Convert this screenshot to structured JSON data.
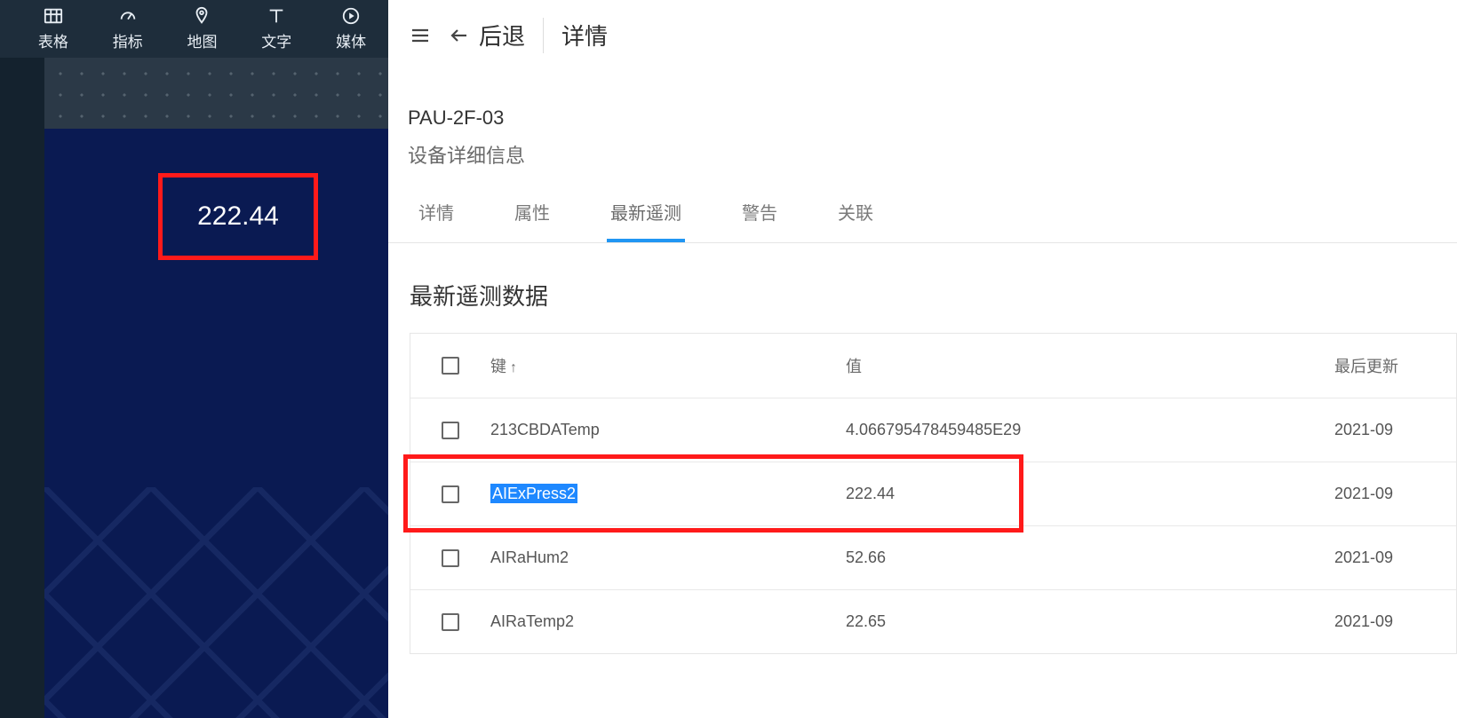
{
  "toolbar": {
    "items": [
      {
        "id": "table",
        "label": "表格"
      },
      {
        "id": "gauge",
        "label": "指标"
      },
      {
        "id": "map",
        "label": "地图"
      },
      {
        "id": "text",
        "label": "文字"
      },
      {
        "id": "media",
        "label": "媒体"
      }
    ]
  },
  "card": {
    "value": "222.44"
  },
  "header": {
    "back": "后退",
    "title": "详情"
  },
  "device": {
    "name": "PAU-2F-03",
    "sub": "设备详细信息"
  },
  "tabs": [
    {
      "id": "detail",
      "label": "详情"
    },
    {
      "id": "attr",
      "label": "属性"
    },
    {
      "id": "telemetry",
      "label": "最新遥测",
      "active": true
    },
    {
      "id": "alarm",
      "label": "警告"
    },
    {
      "id": "relation",
      "label": "关联"
    }
  ],
  "sectionTitle": "最新遥测数据",
  "columns": {
    "key": "键",
    "value": "值",
    "time": "最后更新"
  },
  "rows": [
    {
      "key": "213CBDATemp",
      "value": "4.066795478459485E29",
      "time": "2021-09"
    },
    {
      "key": "AIExPress2",
      "value": "222.44",
      "time": "2021-09",
      "highlight": true
    },
    {
      "key": "AIRaHum2",
      "value": "52.66",
      "time": "2021-09"
    },
    {
      "key": "AIRaTemp2",
      "value": "22.65",
      "time": "2021-09"
    }
  ]
}
